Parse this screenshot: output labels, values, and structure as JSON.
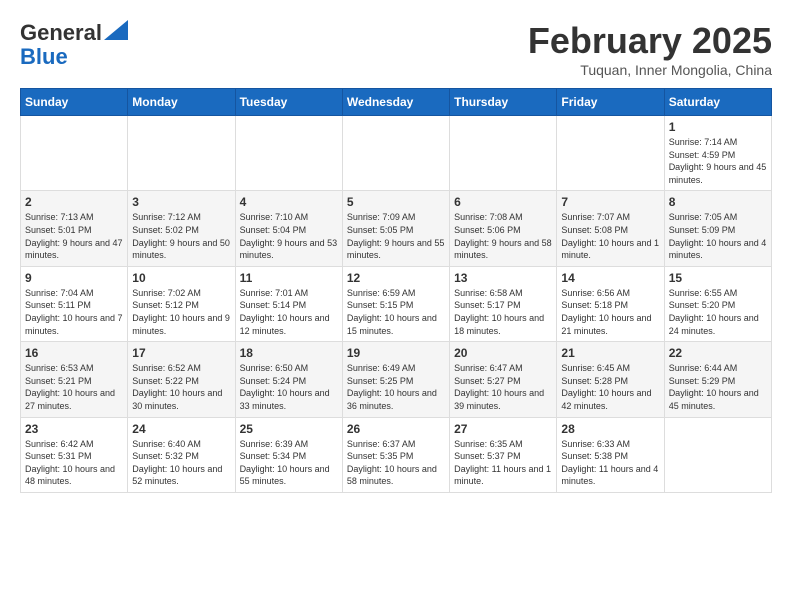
{
  "header": {
    "logo_line1": "General",
    "logo_line2": "Blue",
    "month_title": "February 2025",
    "location": "Tuquan, Inner Mongolia, China"
  },
  "weekdays": [
    "Sunday",
    "Monday",
    "Tuesday",
    "Wednesday",
    "Thursday",
    "Friday",
    "Saturday"
  ],
  "weeks": [
    [
      {
        "day": "",
        "info": ""
      },
      {
        "day": "",
        "info": ""
      },
      {
        "day": "",
        "info": ""
      },
      {
        "day": "",
        "info": ""
      },
      {
        "day": "",
        "info": ""
      },
      {
        "day": "",
        "info": ""
      },
      {
        "day": "1",
        "info": "Sunrise: 7:14 AM\nSunset: 4:59 PM\nDaylight: 9 hours and 45 minutes."
      }
    ],
    [
      {
        "day": "2",
        "info": "Sunrise: 7:13 AM\nSunset: 5:01 PM\nDaylight: 9 hours and 47 minutes."
      },
      {
        "day": "3",
        "info": "Sunrise: 7:12 AM\nSunset: 5:02 PM\nDaylight: 9 hours and 50 minutes."
      },
      {
        "day": "4",
        "info": "Sunrise: 7:10 AM\nSunset: 5:04 PM\nDaylight: 9 hours and 53 minutes."
      },
      {
        "day": "5",
        "info": "Sunrise: 7:09 AM\nSunset: 5:05 PM\nDaylight: 9 hours and 55 minutes."
      },
      {
        "day": "6",
        "info": "Sunrise: 7:08 AM\nSunset: 5:06 PM\nDaylight: 9 hours and 58 minutes."
      },
      {
        "day": "7",
        "info": "Sunrise: 7:07 AM\nSunset: 5:08 PM\nDaylight: 10 hours and 1 minute."
      },
      {
        "day": "8",
        "info": "Sunrise: 7:05 AM\nSunset: 5:09 PM\nDaylight: 10 hours and 4 minutes."
      }
    ],
    [
      {
        "day": "9",
        "info": "Sunrise: 7:04 AM\nSunset: 5:11 PM\nDaylight: 10 hours and 7 minutes."
      },
      {
        "day": "10",
        "info": "Sunrise: 7:02 AM\nSunset: 5:12 PM\nDaylight: 10 hours and 9 minutes."
      },
      {
        "day": "11",
        "info": "Sunrise: 7:01 AM\nSunset: 5:14 PM\nDaylight: 10 hours and 12 minutes."
      },
      {
        "day": "12",
        "info": "Sunrise: 6:59 AM\nSunset: 5:15 PM\nDaylight: 10 hours and 15 minutes."
      },
      {
        "day": "13",
        "info": "Sunrise: 6:58 AM\nSunset: 5:17 PM\nDaylight: 10 hours and 18 minutes."
      },
      {
        "day": "14",
        "info": "Sunrise: 6:56 AM\nSunset: 5:18 PM\nDaylight: 10 hours and 21 minutes."
      },
      {
        "day": "15",
        "info": "Sunrise: 6:55 AM\nSunset: 5:20 PM\nDaylight: 10 hours and 24 minutes."
      }
    ],
    [
      {
        "day": "16",
        "info": "Sunrise: 6:53 AM\nSunset: 5:21 PM\nDaylight: 10 hours and 27 minutes."
      },
      {
        "day": "17",
        "info": "Sunrise: 6:52 AM\nSunset: 5:22 PM\nDaylight: 10 hours and 30 minutes."
      },
      {
        "day": "18",
        "info": "Sunrise: 6:50 AM\nSunset: 5:24 PM\nDaylight: 10 hours and 33 minutes."
      },
      {
        "day": "19",
        "info": "Sunrise: 6:49 AM\nSunset: 5:25 PM\nDaylight: 10 hours and 36 minutes."
      },
      {
        "day": "20",
        "info": "Sunrise: 6:47 AM\nSunset: 5:27 PM\nDaylight: 10 hours and 39 minutes."
      },
      {
        "day": "21",
        "info": "Sunrise: 6:45 AM\nSunset: 5:28 PM\nDaylight: 10 hours and 42 minutes."
      },
      {
        "day": "22",
        "info": "Sunrise: 6:44 AM\nSunset: 5:29 PM\nDaylight: 10 hours and 45 minutes."
      }
    ],
    [
      {
        "day": "23",
        "info": "Sunrise: 6:42 AM\nSunset: 5:31 PM\nDaylight: 10 hours and 48 minutes."
      },
      {
        "day": "24",
        "info": "Sunrise: 6:40 AM\nSunset: 5:32 PM\nDaylight: 10 hours and 52 minutes."
      },
      {
        "day": "25",
        "info": "Sunrise: 6:39 AM\nSunset: 5:34 PM\nDaylight: 10 hours and 55 minutes."
      },
      {
        "day": "26",
        "info": "Sunrise: 6:37 AM\nSunset: 5:35 PM\nDaylight: 10 hours and 58 minutes."
      },
      {
        "day": "27",
        "info": "Sunrise: 6:35 AM\nSunset: 5:37 PM\nDaylight: 11 hours and 1 minute."
      },
      {
        "day": "28",
        "info": "Sunrise: 6:33 AM\nSunset: 5:38 PM\nDaylight: 11 hours and 4 minutes."
      },
      {
        "day": "",
        "info": ""
      }
    ]
  ]
}
